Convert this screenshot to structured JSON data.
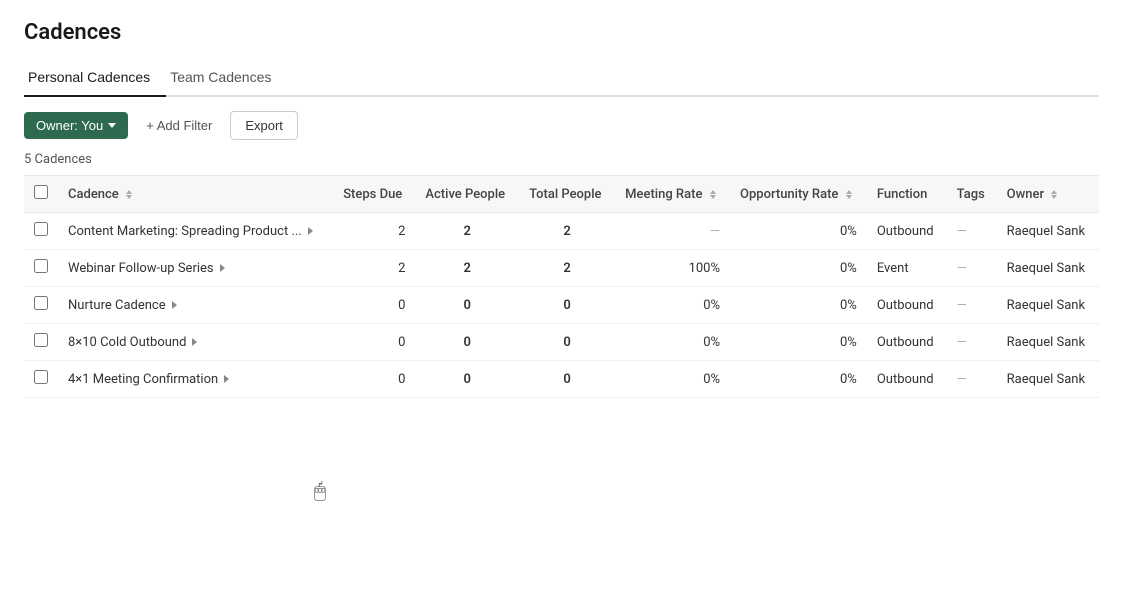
{
  "page": {
    "title": "Cadences"
  },
  "tabs": [
    {
      "id": "personal",
      "label": "Personal Cadences",
      "active": true
    },
    {
      "id": "team",
      "label": "Team Cadences",
      "active": false
    }
  ],
  "toolbar": {
    "owner_button": "Owner: You",
    "add_filter": "+ Add Filter",
    "export": "Export"
  },
  "count_label": "5 Cadences",
  "table": {
    "columns": [
      {
        "id": "cadence",
        "label": "Cadence",
        "sortable": true
      },
      {
        "id": "steps_due",
        "label": "Steps Due",
        "sortable": false
      },
      {
        "id": "active_people",
        "label": "Active People",
        "sortable": false
      },
      {
        "id": "total_people",
        "label": "Total People",
        "sortable": false
      },
      {
        "id": "meeting_rate",
        "label": "Meeting Rate",
        "sortable": true
      },
      {
        "id": "opportunity_rate",
        "label": "Opportunity Rate",
        "sortable": true
      },
      {
        "id": "function",
        "label": "Function",
        "sortable": false
      },
      {
        "id": "tags",
        "label": "Tags",
        "sortable": false
      },
      {
        "id": "owner",
        "label": "Owner",
        "sortable": true
      }
    ],
    "rows": [
      {
        "name": "Content Marketing: Spreading Product ...",
        "steps_due": "2",
        "active_people": "2",
        "total_people": "2",
        "meeting_rate": "—",
        "opportunity_rate": "0%",
        "function": "Outbound",
        "tags": "—",
        "owner": "Raequel Sank"
      },
      {
        "name": "Webinar Follow-up Series",
        "steps_due": "2",
        "active_people": "2",
        "total_people": "2",
        "meeting_rate": "100%",
        "opportunity_rate": "0%",
        "function": "Event",
        "tags": "—",
        "owner": "Raequel Sank"
      },
      {
        "name": "Nurture Cadence",
        "steps_due": "0",
        "active_people": "0",
        "total_people": "0",
        "meeting_rate": "0%",
        "opportunity_rate": "0%",
        "function": "Outbound",
        "tags": "—",
        "owner": "Raequel Sank"
      },
      {
        "name": "8×10 Cold Outbound",
        "steps_due": "0",
        "active_people": "0",
        "total_people": "0",
        "meeting_rate": "0%",
        "opportunity_rate": "0%",
        "function": "Outbound",
        "tags": "—",
        "owner": "Raequel Sank"
      },
      {
        "name": "4×1 Meeting Confirmation",
        "steps_due": "0",
        "active_people": "0",
        "total_people": "0",
        "meeting_rate": "0%",
        "opportunity_rate": "0%",
        "function": "Outbound",
        "tags": "—",
        "owner": "Raequel Sank"
      }
    ]
  }
}
